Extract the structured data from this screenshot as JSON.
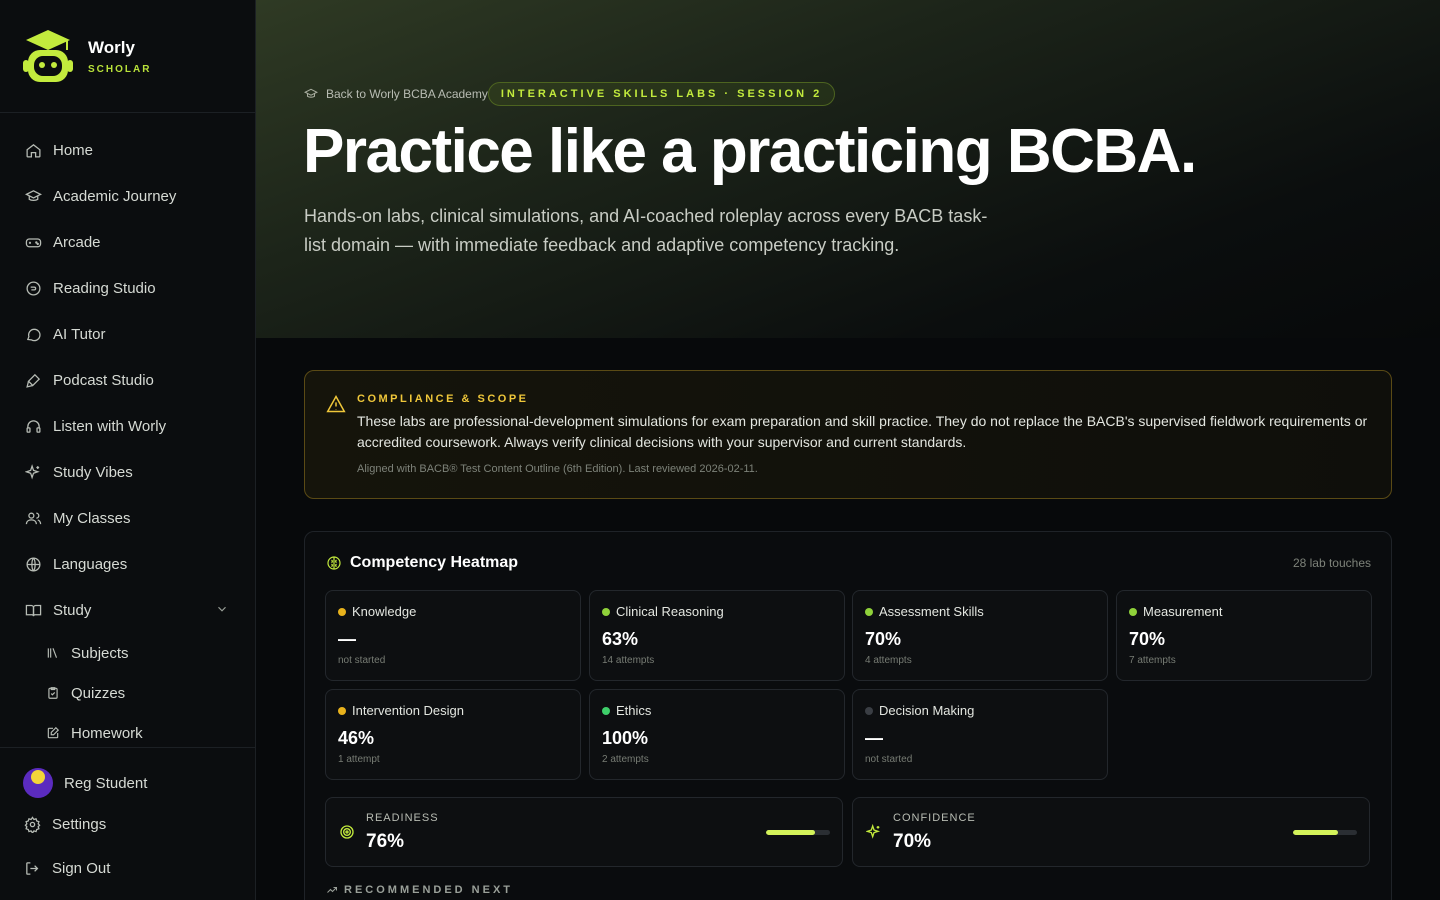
{
  "brand": {
    "name": "Worly",
    "sub": "SCHOLAR"
  },
  "nav": [
    {
      "label": "Home",
      "icon": "home-icon"
    },
    {
      "label": "Academic Journey",
      "icon": "graduation-cap-icon"
    },
    {
      "label": "Arcade",
      "icon": "gamepad-icon"
    },
    {
      "label": "Reading Studio",
      "icon": "book-circle-icon"
    },
    {
      "label": "AI Tutor",
      "icon": "chat-bubble-icon"
    },
    {
      "label": "Podcast Studio",
      "icon": "microphone-icon"
    },
    {
      "label": "Listen with Worly",
      "icon": "headphones-icon"
    },
    {
      "label": "Study Vibes",
      "icon": "sparkles-icon"
    },
    {
      "label": "My Classes",
      "icon": "users-icon"
    },
    {
      "label": "Languages",
      "icon": "globe-icon"
    },
    {
      "label": "Study",
      "icon": "open-book-icon"
    }
  ],
  "study_sub": [
    {
      "label": "Subjects",
      "icon": "library-icon"
    },
    {
      "label": "Quizzes",
      "icon": "clipboard-check-icon"
    },
    {
      "label": "Homework",
      "icon": "edit-icon"
    }
  ],
  "user": {
    "name": "Reg Student"
  },
  "bottom": {
    "settings": "Settings",
    "signout": "Sign Out"
  },
  "hero": {
    "crumb": "Back to Worly BCBA Academy",
    "pill": "INTERACTIVE SKILLS LABS · SESSION 2",
    "title": "Practice like a practicing BCBA.",
    "subtitle": "Hands-on labs, clinical simulations, and AI-coached roleplay across every BACB task-list domain — with immediate feedback and adaptive competency tracking."
  },
  "compliance": {
    "label": "COMPLIANCE & SCOPE",
    "text": "These labs are professional-development simulations for exam preparation and skill practice. They do not replace the BACB's supervised fieldwork requirements or accredited coursework. Always verify clinical decisions with your supervisor and current standards.",
    "note": "Aligned with BACB® Test Content Outline (6th Edition). Last reviewed 2026-02-11."
  },
  "heatmap": {
    "title": "Competency Heatmap",
    "count": "28 lab touches",
    "cells": [
      {
        "name": "Knowledge",
        "value": "—",
        "attempts": "not started",
        "dot": "#e8b21c"
      },
      {
        "name": "Clinical Reasoning",
        "value": "63%",
        "attempts": "14 attempts",
        "dot": "#8fd13a"
      },
      {
        "name": "Assessment Skills",
        "value": "70%",
        "attempts": "4 attempts",
        "dot": "#8fd13a"
      },
      {
        "name": "Measurement",
        "value": "70%",
        "attempts": "7 attempts",
        "dot": "#8fd13a"
      },
      {
        "name": "Intervention Design",
        "value": "46%",
        "attempts": "1 attempt",
        "dot": "#e8b21c"
      },
      {
        "name": "Ethics",
        "value": "100%",
        "attempts": "2 attempts",
        "dot": "#3ecf6a"
      },
      {
        "name": "Decision Making",
        "value": "—",
        "attempts": "not started",
        "dot": "#3a3e44"
      }
    ],
    "readiness": {
      "label": "READINESS",
      "value": "76%",
      "fraction": 0.76
    },
    "confidence": {
      "label": "CONFIDENCE",
      "value": "70%",
      "fraction": 0.7
    },
    "recommended": "RECOMMENDED NEXT"
  }
}
